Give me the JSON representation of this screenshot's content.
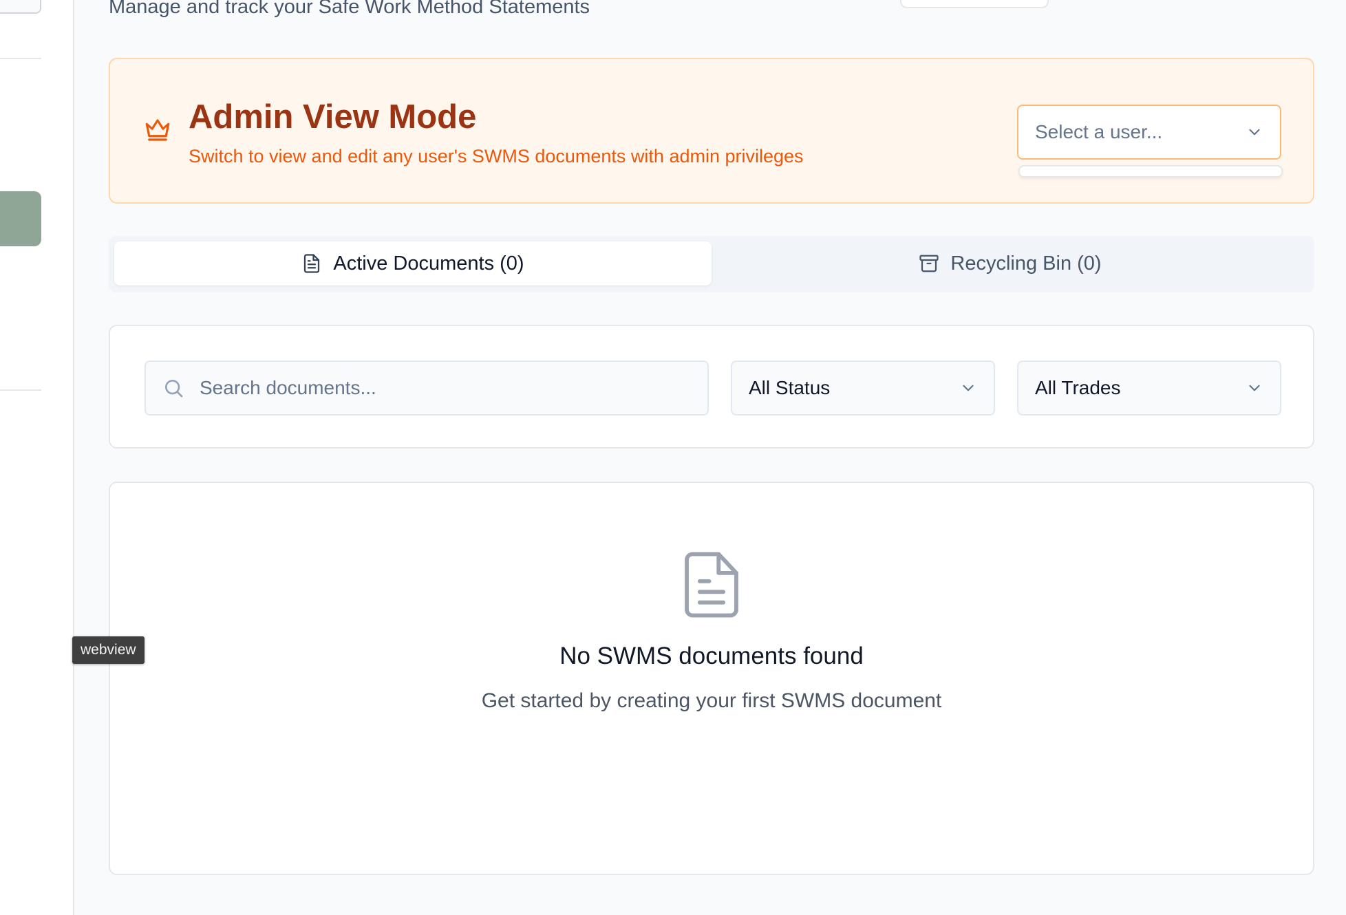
{
  "header": {
    "subtitle": "Manage and track your Safe Work Method Statements"
  },
  "admin_banner": {
    "icon": "crown-icon",
    "title": "Admin View Mode",
    "description": "Switch to view and edit any user's SWMS documents with admin privileges",
    "user_select": {
      "placeholder": "Select a user...",
      "options": []
    },
    "colors": {
      "background": "#fff7ed",
      "title": "#9a3412",
      "description": "#ea580c"
    }
  },
  "tabs": [
    {
      "label": "Active Documents (0)",
      "icon": "document-icon",
      "active": true
    },
    {
      "label": "Recycling Bin (0)",
      "icon": "archive-icon",
      "active": false
    }
  ],
  "filters": {
    "search_placeholder": "Search documents...",
    "status_selected": "All Status",
    "trades_selected": "All Trades"
  },
  "empty_state": {
    "icon": "document-icon",
    "title": "No SWMS documents found",
    "description": "Get started by creating your first SWMS document"
  },
  "overlay": {
    "tooltip": "webview"
  },
  "sidebar": {
    "active_color": "#8fa596"
  }
}
